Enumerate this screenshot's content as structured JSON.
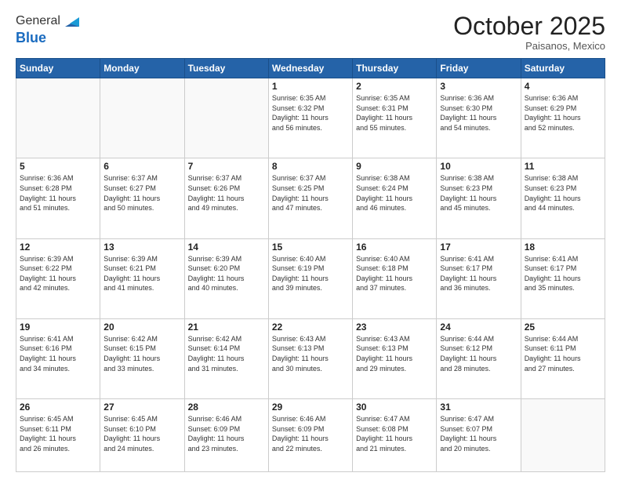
{
  "header": {
    "logo_line1": "General",
    "logo_line2": "Blue",
    "month": "October 2025",
    "location": "Paisanos, Mexico"
  },
  "days_of_week": [
    "Sunday",
    "Monday",
    "Tuesday",
    "Wednesday",
    "Thursday",
    "Friday",
    "Saturday"
  ],
  "weeks": [
    [
      {
        "day": "",
        "info": ""
      },
      {
        "day": "",
        "info": ""
      },
      {
        "day": "",
        "info": ""
      },
      {
        "day": "1",
        "info": "Sunrise: 6:35 AM\nSunset: 6:32 PM\nDaylight: 11 hours\nand 56 minutes."
      },
      {
        "day": "2",
        "info": "Sunrise: 6:35 AM\nSunset: 6:31 PM\nDaylight: 11 hours\nand 55 minutes."
      },
      {
        "day": "3",
        "info": "Sunrise: 6:36 AM\nSunset: 6:30 PM\nDaylight: 11 hours\nand 54 minutes."
      },
      {
        "day": "4",
        "info": "Sunrise: 6:36 AM\nSunset: 6:29 PM\nDaylight: 11 hours\nand 52 minutes."
      }
    ],
    [
      {
        "day": "5",
        "info": "Sunrise: 6:36 AM\nSunset: 6:28 PM\nDaylight: 11 hours\nand 51 minutes."
      },
      {
        "day": "6",
        "info": "Sunrise: 6:37 AM\nSunset: 6:27 PM\nDaylight: 11 hours\nand 50 minutes."
      },
      {
        "day": "7",
        "info": "Sunrise: 6:37 AM\nSunset: 6:26 PM\nDaylight: 11 hours\nand 49 minutes."
      },
      {
        "day": "8",
        "info": "Sunrise: 6:37 AM\nSunset: 6:25 PM\nDaylight: 11 hours\nand 47 minutes."
      },
      {
        "day": "9",
        "info": "Sunrise: 6:38 AM\nSunset: 6:24 PM\nDaylight: 11 hours\nand 46 minutes."
      },
      {
        "day": "10",
        "info": "Sunrise: 6:38 AM\nSunset: 6:23 PM\nDaylight: 11 hours\nand 45 minutes."
      },
      {
        "day": "11",
        "info": "Sunrise: 6:38 AM\nSunset: 6:23 PM\nDaylight: 11 hours\nand 44 minutes."
      }
    ],
    [
      {
        "day": "12",
        "info": "Sunrise: 6:39 AM\nSunset: 6:22 PM\nDaylight: 11 hours\nand 42 minutes."
      },
      {
        "day": "13",
        "info": "Sunrise: 6:39 AM\nSunset: 6:21 PM\nDaylight: 11 hours\nand 41 minutes."
      },
      {
        "day": "14",
        "info": "Sunrise: 6:39 AM\nSunset: 6:20 PM\nDaylight: 11 hours\nand 40 minutes."
      },
      {
        "day": "15",
        "info": "Sunrise: 6:40 AM\nSunset: 6:19 PM\nDaylight: 11 hours\nand 39 minutes."
      },
      {
        "day": "16",
        "info": "Sunrise: 6:40 AM\nSunset: 6:18 PM\nDaylight: 11 hours\nand 37 minutes."
      },
      {
        "day": "17",
        "info": "Sunrise: 6:41 AM\nSunset: 6:17 PM\nDaylight: 11 hours\nand 36 minutes."
      },
      {
        "day": "18",
        "info": "Sunrise: 6:41 AM\nSunset: 6:17 PM\nDaylight: 11 hours\nand 35 minutes."
      }
    ],
    [
      {
        "day": "19",
        "info": "Sunrise: 6:41 AM\nSunset: 6:16 PM\nDaylight: 11 hours\nand 34 minutes."
      },
      {
        "day": "20",
        "info": "Sunrise: 6:42 AM\nSunset: 6:15 PM\nDaylight: 11 hours\nand 33 minutes."
      },
      {
        "day": "21",
        "info": "Sunrise: 6:42 AM\nSunset: 6:14 PM\nDaylight: 11 hours\nand 31 minutes."
      },
      {
        "day": "22",
        "info": "Sunrise: 6:43 AM\nSunset: 6:13 PM\nDaylight: 11 hours\nand 30 minutes."
      },
      {
        "day": "23",
        "info": "Sunrise: 6:43 AM\nSunset: 6:13 PM\nDaylight: 11 hours\nand 29 minutes."
      },
      {
        "day": "24",
        "info": "Sunrise: 6:44 AM\nSunset: 6:12 PM\nDaylight: 11 hours\nand 28 minutes."
      },
      {
        "day": "25",
        "info": "Sunrise: 6:44 AM\nSunset: 6:11 PM\nDaylight: 11 hours\nand 27 minutes."
      }
    ],
    [
      {
        "day": "26",
        "info": "Sunrise: 6:45 AM\nSunset: 6:11 PM\nDaylight: 11 hours\nand 26 minutes."
      },
      {
        "day": "27",
        "info": "Sunrise: 6:45 AM\nSunset: 6:10 PM\nDaylight: 11 hours\nand 24 minutes."
      },
      {
        "day": "28",
        "info": "Sunrise: 6:46 AM\nSunset: 6:09 PM\nDaylight: 11 hours\nand 23 minutes."
      },
      {
        "day": "29",
        "info": "Sunrise: 6:46 AM\nSunset: 6:09 PM\nDaylight: 11 hours\nand 22 minutes."
      },
      {
        "day": "30",
        "info": "Sunrise: 6:47 AM\nSunset: 6:08 PM\nDaylight: 11 hours\nand 21 minutes."
      },
      {
        "day": "31",
        "info": "Sunrise: 6:47 AM\nSunset: 6:07 PM\nDaylight: 11 hours\nand 20 minutes."
      },
      {
        "day": "",
        "info": ""
      }
    ]
  ]
}
